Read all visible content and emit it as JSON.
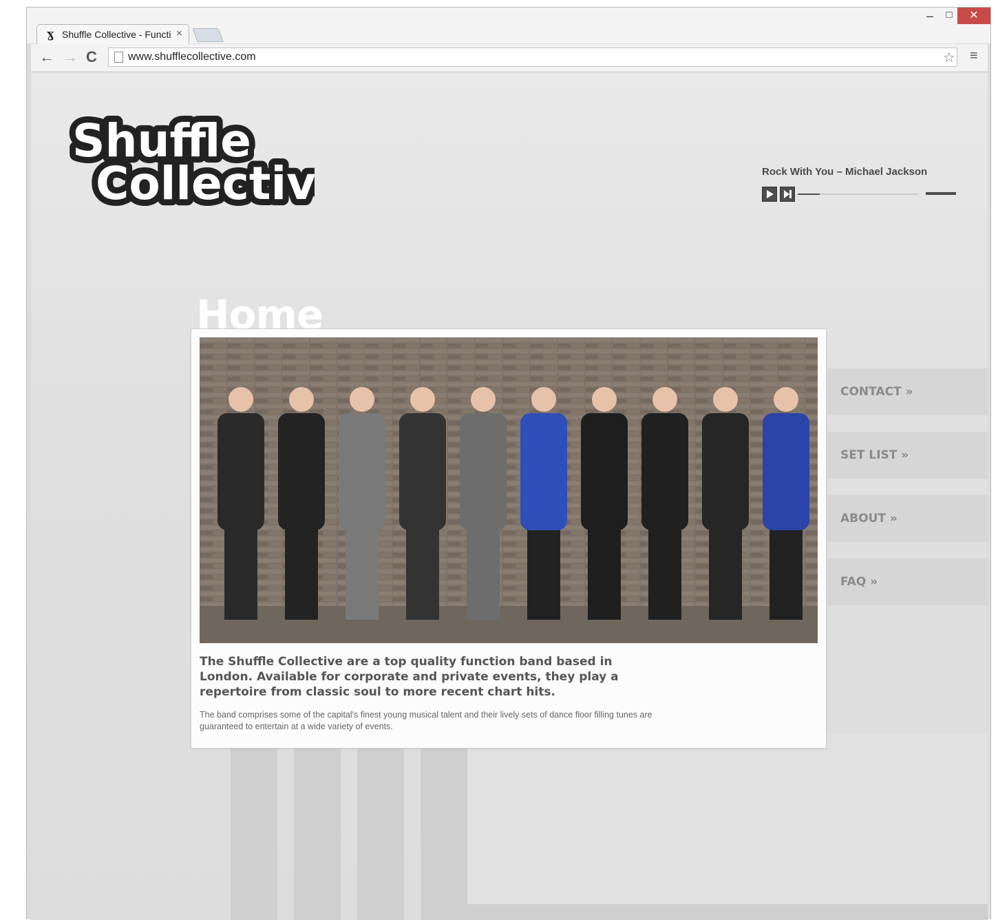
{
  "browser": {
    "tab_title": "Shuffle Collective - Functi",
    "tab_close": "×",
    "favicon": "ɣ",
    "url": "www.shufflecollective.com",
    "window_controls": {
      "minimize": "‒",
      "maximize": "□",
      "close": "✕"
    },
    "nav": {
      "back": "←",
      "forward": "→",
      "reload": "C"
    },
    "star": "☆",
    "menu": "≡"
  },
  "site": {
    "logo": {
      "line1": "Shuffle",
      "line2": "Collective"
    },
    "player": {
      "now_playing": "Rock With You – Michael Jackson",
      "progress_fraction": 0.18,
      "volume_fraction": 1.0
    },
    "page_heading": "Home",
    "intro": {
      "lead": "The Shuffle Collective are a top quality function band based in London. Available for corporate and private events, they play a repertoire from classic soul to more recent chart hits.",
      "body": "The band comprises some of the capital's finest young musical talent and their lively sets of dance floor filling tunes are guaranteed to entertain at a wide variety of events."
    },
    "nav": [
      {
        "label": "CONTACT »"
      },
      {
        "label": "SET LIST »"
      },
      {
        "label": "ABOUT »"
      },
      {
        "label": "FAQ »"
      }
    ],
    "photo_alt": "band-photo",
    "colors": {
      "background": "#e0e0e0",
      "heading": "#ffffff",
      "nav_bg": "#d6d6d6",
      "nav_text": "#8a8a8a",
      "close_button": "#c84b47"
    }
  }
}
